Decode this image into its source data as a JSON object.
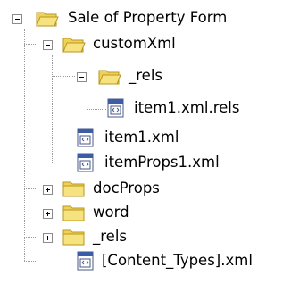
{
  "tree": {
    "root": {
      "label": "Sale of Property Form",
      "icon": "folder-open-icon",
      "expanded": true
    },
    "customXml": {
      "label": "customXml",
      "icon": "folder-open-icon",
      "expanded": true
    },
    "customXml_rels": {
      "label": "_rels",
      "icon": "folder-open-icon",
      "expanded": true
    },
    "item1_xml_rels": {
      "label": "item1.xml.rels",
      "icon": "xml-file-icon"
    },
    "item1_xml": {
      "label": "item1.xml",
      "icon": "xml-file-icon"
    },
    "itemProps1_xml": {
      "label": "itemProps1.xml",
      "icon": "xml-file-icon"
    },
    "docProps": {
      "label": "docProps",
      "icon": "folder-closed-icon",
      "expanded": false
    },
    "word": {
      "label": "word",
      "icon": "folder-closed-icon",
      "expanded": false
    },
    "root_rels": {
      "label": "_rels",
      "icon": "folder-closed-icon",
      "expanded": false
    },
    "content_types": {
      "label": "[Content_Types].xml",
      "icon": "xml-file-icon"
    }
  },
  "colors": {
    "folder_body": "#f6e27f",
    "folder_edge": "#b8961e",
    "folder_tab": "#efd15a",
    "file_edge": "#4a5a8a",
    "file_band": "#3b5da8",
    "tree_lines": "#9a9a9a"
  }
}
